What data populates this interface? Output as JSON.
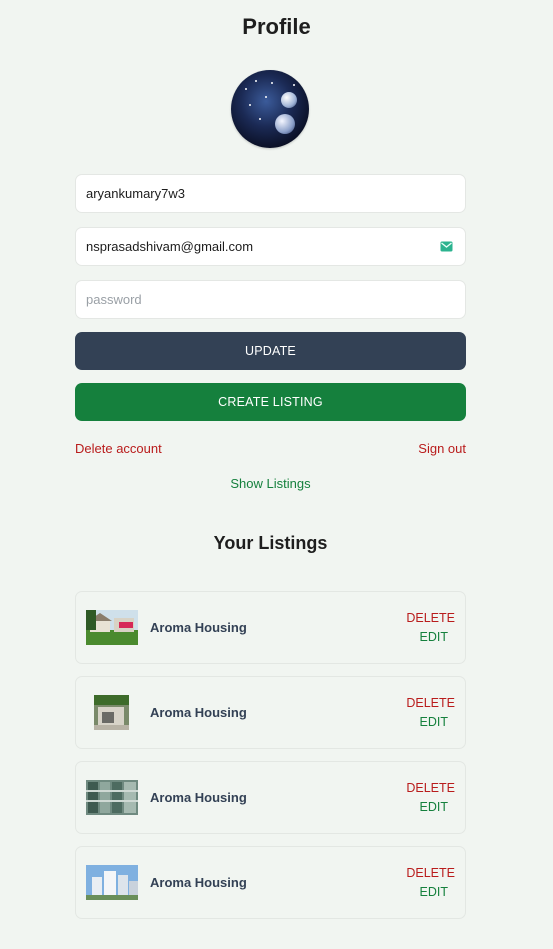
{
  "page": {
    "title": "Profile"
  },
  "form": {
    "username": "aryankumary7w3",
    "email": "nsprasadshivam@gmail.com",
    "password_placeholder": "password",
    "update_label": "UPDATE",
    "create_label": "CREATE LISTING"
  },
  "actions": {
    "delete_account": "Delete account",
    "sign_out": "Sign out",
    "show_listings": "Show Listings"
  },
  "listings": {
    "title": "Your Listings",
    "items": [
      {
        "name": "Aroma Housing",
        "delete_label": "DELETE",
        "edit_label": "EDIT"
      },
      {
        "name": "Aroma Housing",
        "delete_label": "DELETE",
        "edit_label": "EDIT"
      },
      {
        "name": "Aroma Housing",
        "delete_label": "DELETE",
        "edit_label": "EDIT"
      },
      {
        "name": "Aroma Housing",
        "delete_label": "DELETE",
        "edit_label": "EDIT"
      }
    ]
  },
  "colors": {
    "background": "#f1f5f1",
    "update_button": "#334155",
    "create_button": "#15803d",
    "danger": "#b91c1c",
    "success": "#15803d"
  }
}
